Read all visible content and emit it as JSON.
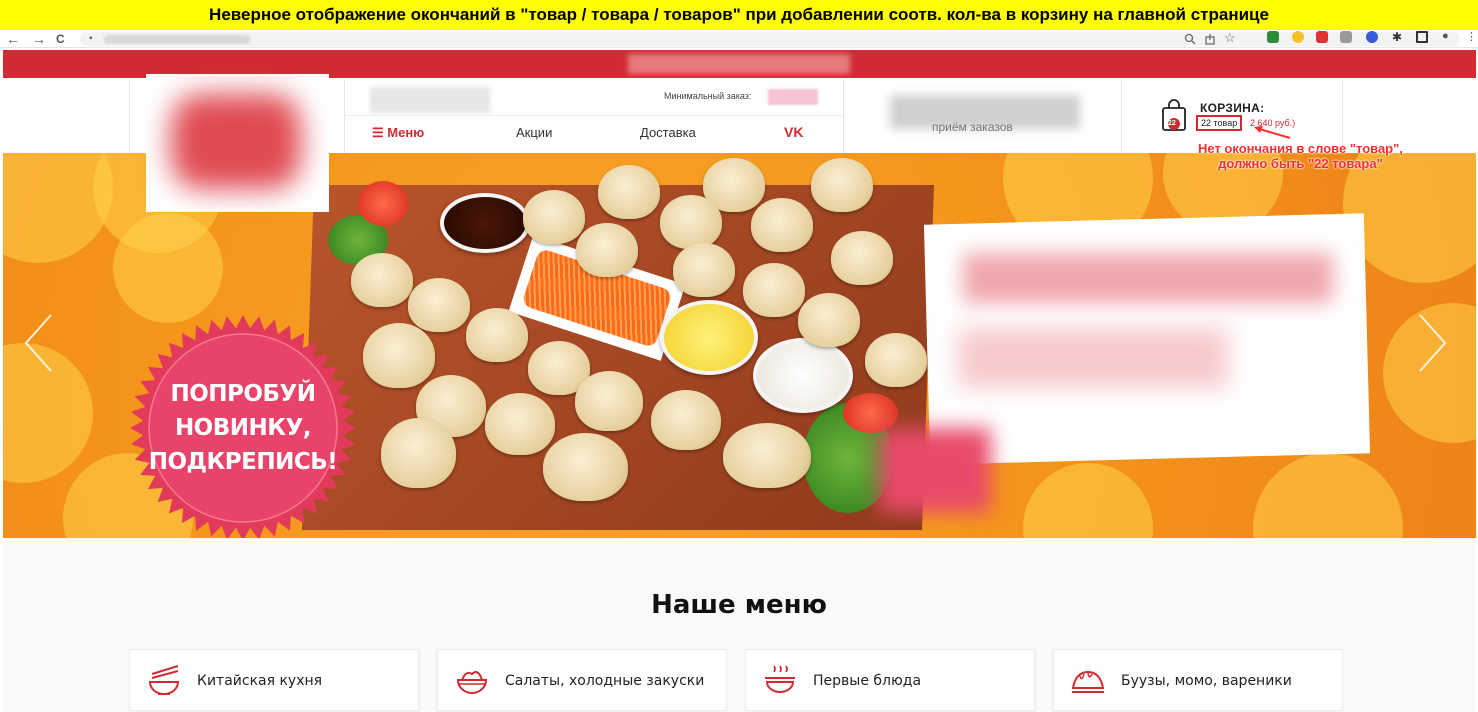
{
  "caption": "Неверное отображение окончаний в \"товар / товара / товаров\" при добавлении соотв. кол-ва в корзину на главной странице",
  "browser": {
    "back_icon": "←",
    "forward_icon": "→",
    "reload_icon": "C",
    "lock_icon": "🔒"
  },
  "header": {
    "min_order_label": "Минимальный заказ:",
    "nav": {
      "menu": "☰ Меню",
      "promos": "Акции",
      "delivery": "Доставка",
      "vk": "VK"
    },
    "center_text": "приём заказов"
  },
  "cart": {
    "title": "КОРЗИНА:",
    "badge_count": "22",
    "count_text": "22 товар",
    "price_text": "2 640 руб.)"
  },
  "annotation": {
    "line1": "Нет окончания в слове \"товар\",",
    "line2": "должно быть \"22 товара\""
  },
  "banner": {
    "badge_line1": "ПОПРОБУЙ",
    "badge_line2": "НОВИНКУ,",
    "badge_line3": "ПОДКРЕПИСЬ!"
  },
  "menu_section": {
    "title": "Наше меню",
    "categories": [
      {
        "label": "Китайская кухня",
        "icon": "noodles-icon"
      },
      {
        "label": "Салаты, холодные закуски",
        "icon": "salad-bowl-icon"
      },
      {
        "label": "Первые блюда",
        "icon": "soup-bowl-icon"
      },
      {
        "label": "Буузы, момо, вареники",
        "icon": "dumpling-icon"
      }
    ]
  },
  "colors": {
    "brand_red": "#d12a32",
    "caption_bg": "#ffff00",
    "banner_orange": "#f5961b"
  }
}
